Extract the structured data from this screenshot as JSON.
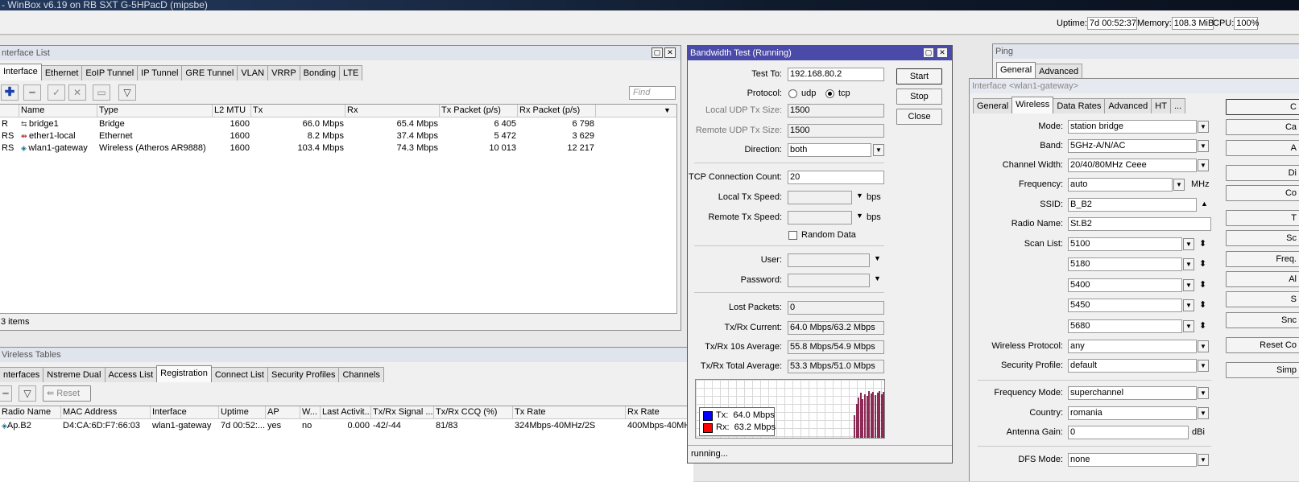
{
  "app": {
    "title": "- WinBox v6.19 on RB SXT G-5HPacD (mipsbe)"
  },
  "status": {
    "uptime_label": "Uptime:",
    "uptime": "7d 00:52:37",
    "memory_label": "Memory:",
    "memory": "108.3 MiB",
    "cpu_label": "CPU:",
    "cpu": "100%"
  },
  "iface_list": {
    "title": "nterface List",
    "tabs": [
      "Interface",
      "Ethernet",
      "EoIP Tunnel",
      "IP Tunnel",
      "GRE Tunnel",
      "VLAN",
      "VRRP",
      "Bonding",
      "LTE"
    ],
    "find_placeholder": "Find",
    "columns": [
      "Name",
      "Type",
      "L2 MTU",
      "Tx",
      "Rx",
      "Tx Packet (p/s)",
      "Rx Packet (p/s)"
    ],
    "rows": [
      {
        "flag": "R",
        "name": "bridge1",
        "type": "Bridge",
        "mtu": "1600",
        "tx": "66.0 Mbps",
        "rx": "65.4 Mbps",
        "txp": "6 405",
        "rxp": "6 798"
      },
      {
        "flag": "RS",
        "name": "ether1-local",
        "type": "Ethernet",
        "mtu": "1600",
        "tx": "8.2 Mbps",
        "rx": "37.4 Mbps",
        "txp": "5 472",
        "rxp": "3 629"
      },
      {
        "flag": "RS",
        "name": "wlan1-gateway",
        "type": "Wireless (Atheros AR9888)",
        "mtu": "1600",
        "tx": "103.4 Mbps",
        "rx": "74.3 Mbps",
        "txp": "10 013",
        "rxp": "12 217"
      }
    ],
    "count": "3 items"
  },
  "wireless_tables": {
    "title": "Vireless Tables",
    "tabs": [
      "nterfaces",
      "Nstreme Dual",
      "Access List",
      "Registration",
      "Connect List",
      "Security Profiles",
      "Channels"
    ],
    "reset_label": "Reset",
    "columns": [
      "Radio Name",
      "MAC Address",
      "Interface",
      "Uptime",
      "AP",
      "W...",
      "Last Activit...",
      "Tx/Rx Signal ...",
      "Tx/Rx CCQ (%)",
      "Tx Rate",
      "Rx Rate"
    ],
    "rows": [
      {
        "radio": "Ap.B2",
        "mac": "D4:CA:6D:F7:66:03",
        "iface": "wlan1-gateway",
        "uptime": "7d 00:52:...",
        "ap": "yes",
        "w": "no",
        "last": "0.000",
        "signal": "-42/-44",
        "ccq": "81/83",
        "txrate": "324Mbps-40MHz/2S",
        "rxrate": "400Mbps-40MHz/2S"
      }
    ]
  },
  "bwtest": {
    "title": "Bandwidth Test (Running)",
    "test_to_label": "Test To:",
    "test_to": "192.168.80.2",
    "protocol_label": "Protocol:",
    "udp": "udp",
    "tcp": "tcp",
    "local_udp_label": "Local UDP Tx Size:",
    "local_udp": "1500",
    "remote_udp_label": "Remote UDP Tx Size:",
    "remote_udp": "1500",
    "direction_label": "Direction:",
    "direction": "both",
    "tcp_count_label": "TCP Connection Count:",
    "tcp_count": "20",
    "local_speed_label": "Local Tx Speed:",
    "remote_speed_label": "Remote Tx Speed:",
    "bps": "bps",
    "random_label": "Random Data",
    "user_label": "User:",
    "password_label": "Password:",
    "lost_label": "Lost Packets:",
    "lost": "0",
    "current_label": "Tx/Rx Current:",
    "current": "64.0 Mbps/63.2 Mbps",
    "avg10_label": "Tx/Rx 10s Average:",
    "avg10": "55.8 Mbps/54.9 Mbps",
    "total_label": "Tx/Rx Total Average:",
    "total": "53.3 Mbps/51.0 Mbps",
    "legend_tx": "Tx:  64.0 Mbps",
    "legend_rx": "Rx:  63.2 Mbps",
    "start": "Start",
    "stop": "Stop",
    "close": "Close",
    "status": "running...",
    "tx_color": "#0000ff",
    "rx_color": "#ff0000"
  },
  "ping": {
    "title": "Ping",
    "tabs": [
      "General",
      "Advanced"
    ]
  },
  "wlan": {
    "title": "Interface <wlan1-gateway>",
    "tabs": [
      "General",
      "Wireless",
      "Data Rates",
      "Advanced",
      "HT",
      "..."
    ],
    "mode_label": "Mode:",
    "mode": "station bridge",
    "band_label": "Band:",
    "band": "5GHz-A/N/AC",
    "width_label": "Channel Width:",
    "width": "20/40/80MHz Ceee",
    "freq_label": "Frequency:",
    "freq": "auto",
    "mhz": "MHz",
    "ssid_label": "SSID:",
    "ssid": "B_B2",
    "radio_label": "Radio Name:",
    "radio": "St.B2",
    "scan_label": "Scan List:",
    "scan": [
      "5100",
      "5180",
      "5400",
      "5450",
      "5680"
    ],
    "proto_label": "Wireless Protocol:",
    "proto": "any",
    "sec_label": "Security Profile:",
    "sec": "default",
    "fmode_label": "Frequency Mode:",
    "fmode": "superchannel",
    "country_label": "Country:",
    "country": "romania",
    "gain_label": "Antenna Gain:",
    "gain": "0",
    "dbi": "dBi",
    "dfs_label": "DFS Mode:",
    "dfs": "none",
    "side_buttons": [
      "C",
      "Ca",
      "A",
      "Di",
      "Co",
      "T",
      "Sc",
      "Freq.",
      "Al",
      "S",
      "Snc",
      "Reset Co",
      "Simp"
    ]
  }
}
